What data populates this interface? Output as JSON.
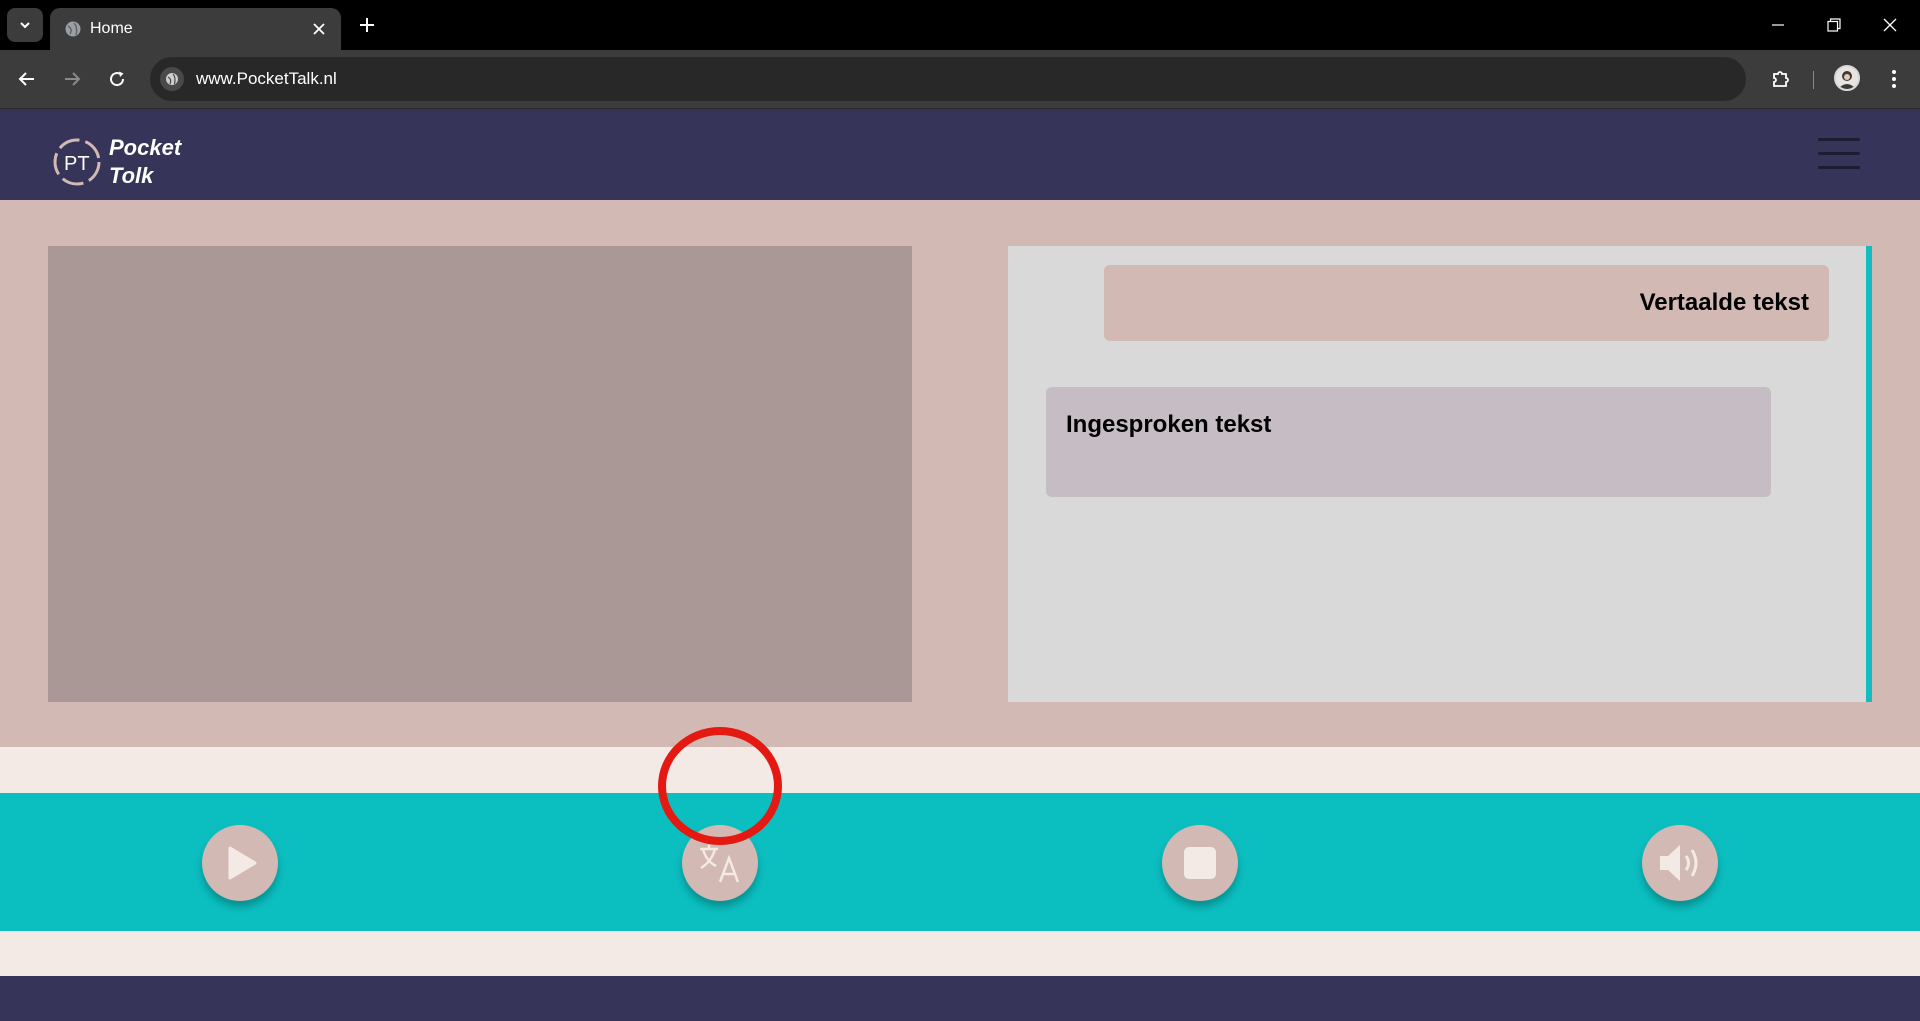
{
  "browser": {
    "tab_title": "Home",
    "url": "www.PocketTalk.nl"
  },
  "app": {
    "logo_line1": "Pocket",
    "logo_line2": "Tolk",
    "logo_mark": "PT"
  },
  "chat": {
    "translated_text": "Vertaalde tekst",
    "spoken_text": "Ingesproken tekst"
  },
  "controls": [
    {
      "name": "play",
      "icon": "play-icon"
    },
    {
      "name": "translate",
      "icon": "translate-icon",
      "highlighted": true
    },
    {
      "name": "stop",
      "icon": "stop-icon"
    },
    {
      "name": "volume",
      "icon": "volume-icon"
    }
  ],
  "colors": {
    "header": "#363459",
    "page_bg": "#d3b9b3",
    "controls_bar": "#0bbfc1",
    "video_area": "#a99896",
    "chat_area": "#d9d9d9",
    "spoken_bubble": "#c6bcc4",
    "highlight_ring": "#e41a12"
  }
}
